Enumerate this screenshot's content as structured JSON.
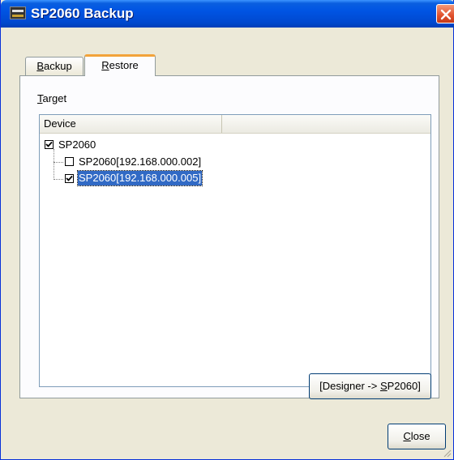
{
  "window": {
    "title": "SP2060 Backup",
    "titlebar_color": "#0054e3",
    "close_button_color": "#e0502c"
  },
  "tabs": [
    {
      "label_ul": "B",
      "label_rest": "ackup",
      "active": false
    },
    {
      "label_ul": "R",
      "label_rest": "estore",
      "active": true
    }
  ],
  "target": {
    "label_ul": "T",
    "label_rest": "arget"
  },
  "tree": {
    "columns": [
      "Device",
      ""
    ],
    "nodes": [
      {
        "label": "SP2060",
        "checked": true,
        "level": 0,
        "selected": false
      },
      {
        "label": "SP2060[192.168.000.002]",
        "checked": false,
        "level": 1,
        "selected": false
      },
      {
        "label": "SP2060[192.168.000.005]",
        "checked": true,
        "level": 1,
        "selected": true
      }
    ],
    "selection_color": "#316ac5"
  },
  "buttons": {
    "designer_pre": "[Designer -> ",
    "designer_ul": "S",
    "designer_post": "P2060]",
    "close_ul": "C",
    "close_rest": "lose"
  },
  "icons": {
    "app": "dme-device-icon",
    "close": "close-x-icon",
    "check": "checkmark-icon"
  }
}
